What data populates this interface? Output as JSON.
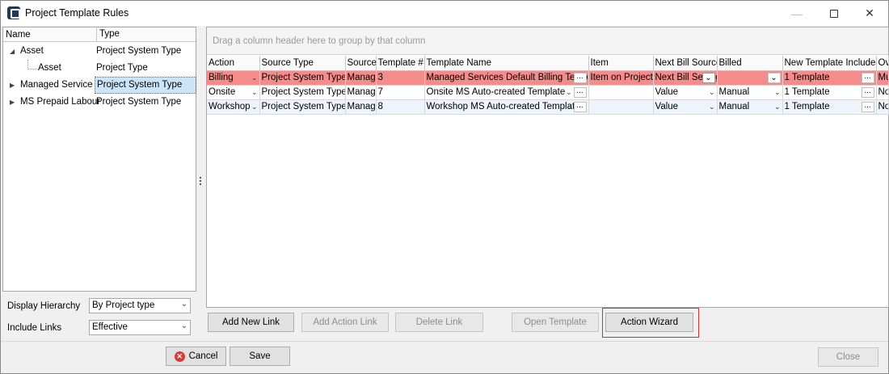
{
  "window": {
    "title": "Project Template Rules",
    "minimize_icon": "minimize-icon",
    "maximize_icon": "maximize-icon",
    "close_icon": "close-icon"
  },
  "tree": {
    "headers": {
      "name": "Name",
      "type": "Type"
    },
    "rows": [
      {
        "name": "Asset",
        "type": "Project System Type",
        "expanded": true
      },
      {
        "name": "Asset",
        "type": "Project Type",
        "child": true
      },
      {
        "name": "Managed Service",
        "type": "Project System Type",
        "selected": true
      },
      {
        "name": "MS Prepaid Labour",
        "type": "Project System Type"
      }
    ]
  },
  "options": {
    "display_hierarchy_label": "Display Hierarchy",
    "display_hierarchy_value": "By Project type",
    "include_links_label": "Include Links",
    "include_links_value": "Effective"
  },
  "grid": {
    "group_hint": "Drag a column header here to group by that column",
    "columns": [
      "Action",
      "Source Type",
      "Source",
      "Template #",
      "Template Name",
      "Item",
      "Next Bill Source",
      "Billed",
      "New Template Includes",
      "Ove"
    ],
    "rows": [
      {
        "action": "Billing",
        "source_type": "Project System Type",
        "source": "Managed Services",
        "template_no": "3",
        "template_name": "Managed Services Default Billing Template",
        "item": "Item on Project",
        "next_bill_source": "Next Bill Setting",
        "billed": "",
        "includes": "1 Template",
        "over": "Must"
      },
      {
        "action": "Onsite",
        "source_type": "Project System Type",
        "source": "Managed Services",
        "template_no": "7",
        "template_name": "Onsite MS Auto-created Template",
        "item": "",
        "next_bill_source": "Value",
        "billed": "Manual",
        "includes": "1 Template",
        "over": "None"
      },
      {
        "action": "Workshop",
        "source_type": "Project System Type",
        "source": "Managed Services",
        "template_no": "8",
        "template_name": "Workshop MS Auto-created Template",
        "item": "",
        "next_bill_source": "Value",
        "billed": "Manual",
        "includes": "1 Template",
        "over": "None"
      }
    ],
    "highlight_color": "#f58c8c"
  },
  "buttons": {
    "add_new_link": "Add New Link",
    "add_action_link": "Add Action Link",
    "delete_link": "Delete Link",
    "open_template": "Open Template",
    "action_wizard": "Action Wizard",
    "cancel": "Cancel",
    "save": "Save",
    "close": "Close"
  }
}
